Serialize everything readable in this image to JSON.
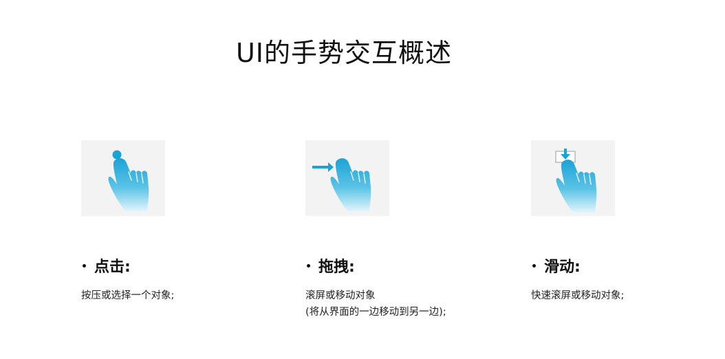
{
  "page": {
    "title": "UI的手势交互概述"
  },
  "gestures": [
    {
      "icon": "tap-hand-icon",
      "heading": "点击:",
      "description": [
        "按压或选择一个对象;"
      ]
    },
    {
      "icon": "drag-hand-icon",
      "heading": "拖拽:",
      "description": [
        "滚屏或移动对象",
        "(将从界面的一边移动到另一边);"
      ]
    },
    {
      "icon": "swipe-hand-icon",
      "heading": "滑动:",
      "description": [
        "快速滚屏或移动对象;"
      ]
    }
  ],
  "colors": {
    "accent": "#1ba3d6",
    "hand_light": "#e6f6fb",
    "image_background": "#f3f3f3",
    "text": "#111111"
  }
}
